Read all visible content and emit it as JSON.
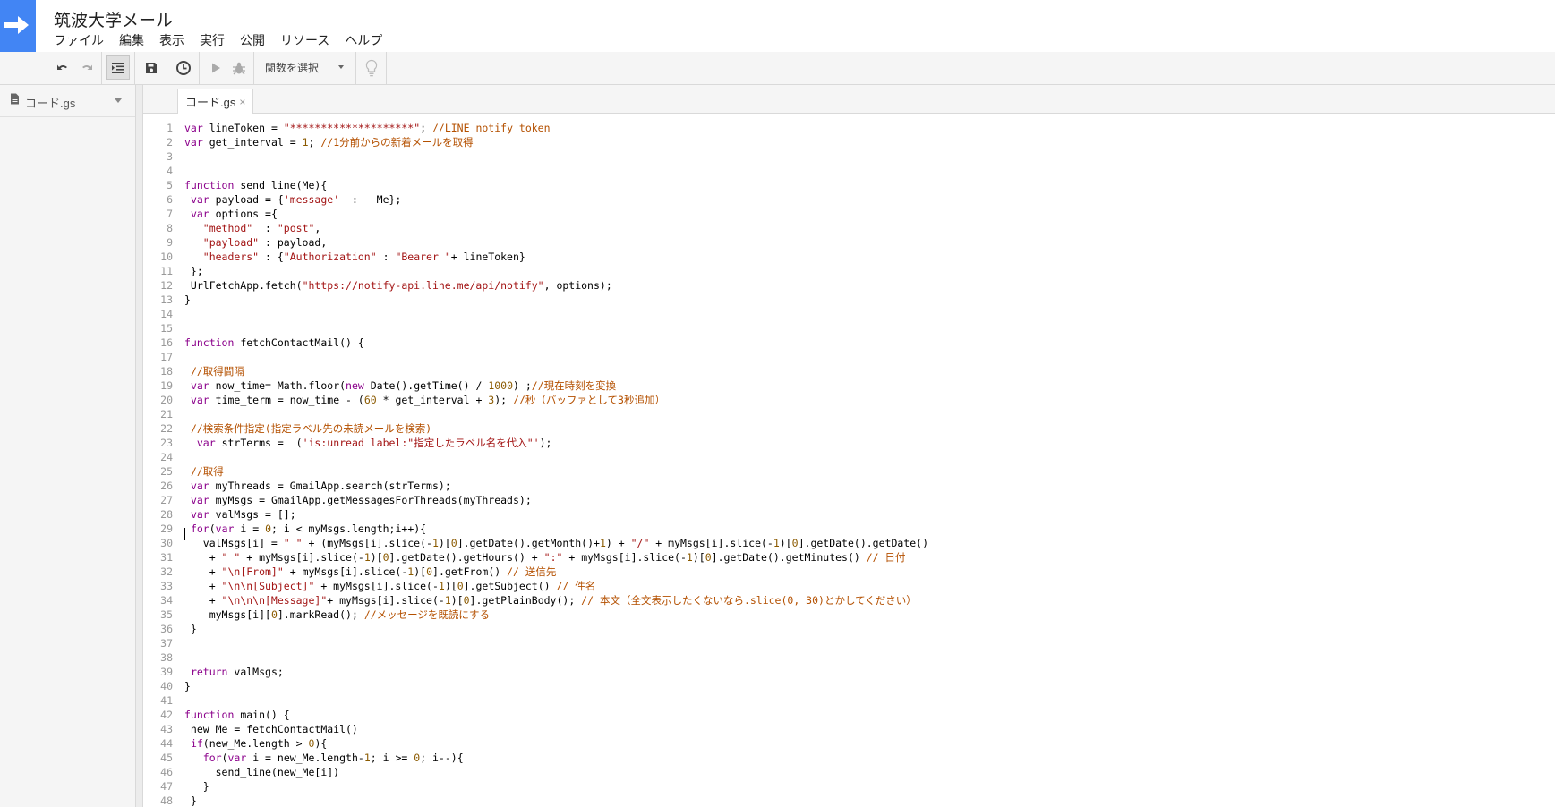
{
  "app": {
    "title": "筑波大学メール",
    "logo_color": "#4285f4"
  },
  "menu": [
    "ファイル",
    "編集",
    "表示",
    "実行",
    "公開",
    "リソース",
    "ヘルプ"
  ],
  "toolbar": {
    "icons": [
      "undo-icon",
      "redo-icon",
      "indent-icon",
      "save-icon",
      "triggers-clock-icon",
      "run-icon",
      "debug-icon",
      "bulb-icon"
    ],
    "function_select": "関数を選択"
  },
  "sidebar": {
    "file_name": "コード.gs"
  },
  "tab": {
    "label": "コード.gs",
    "close": "×"
  },
  "code": {
    "line_numbers": [
      "1",
      "2",
      "3",
      "4",
      "5",
      "6",
      "7",
      "8",
      "9",
      "10",
      "11",
      "12",
      "13",
      "14",
      "15",
      "16",
      "17",
      "18",
      "19",
      "20",
      "21",
      "22",
      "23",
      "24",
      "25",
      "26",
      "27",
      "28",
      "29",
      "30",
      "31",
      "32",
      "33",
      "34",
      "35",
      "36",
      "37",
      "38",
      "39",
      "40",
      "41",
      "42",
      "43",
      "44",
      "45",
      "46",
      "47",
      "48"
    ],
    "lines": [
      "var lineToken = \"********************\"; //LINE notify token",
      "var get_interval = 1; //1分前からの新着メールを取得",
      "",
      "",
      "function send_line(Me){",
      " var payload = {'message'  :   Me};",
      " var options ={",
      "   \"method\"  : \"post\",",
      "   \"payload\" : payload,",
      "   \"headers\" : {\"Authorization\" : \"Bearer \"+ lineToken}",
      " };",
      " UrlFetchApp.fetch(\"https://notify-api.line.me/api/notify\", options);",
      "}",
      "",
      "",
      "function fetchContactMail() {",
      "",
      " //取得間隔",
      " var now_time= Math.floor(new Date().getTime() / 1000) ;//現在時刻を変換",
      " var time_term = now_time - (60 * get_interval + 3); //秒（バッファとして3秒追加）",
      "",
      " //検索条件指定(指定ラベル先の未読メールを検索)",
      "  var strTerms =  ('is:unread label:\"指定したラベル名を代入\"');",
      "",
      " //取得",
      " var myThreads = GmailApp.search(strTerms);",
      " var myMsgs = GmailApp.getMessagesForThreads(myThreads);",
      " var valMsgs = [];",
      " for(var i = 0; i < myMsgs.length;i++){",
      "   valMsgs[i] = \" \" + (myMsgs[i].slice(-1)[0].getDate().getMonth()+1) + \"/\" + myMsgs[i].slice(-1)[0].getDate().getDate()",
      "    + \" \" + myMsgs[i].slice(-1)[0].getDate().getHours() + \":\" + myMsgs[i].slice(-1)[0].getDate().getMinutes() // 日付",
      "    + \"\\n[From]\" + myMsgs[i].slice(-1)[0].getFrom() // 送信先",
      "    + \"\\n\\n[Subject]\" + myMsgs[i].slice(-1)[0].getSubject() // 件名",
      "    + \"\\n\\n\\n[Message]\"+ myMsgs[i].slice(-1)[0].getPlainBody(); // 本文（全文表示したくないなら.slice(0, 30)とかしてください）",
      "    myMsgs[i][0].markRead(); //メッセージを既読にする",
      " }",
      "",
      "",
      " return valMsgs;",
      "}",
      "",
      "function main() {",
      " new_Me = fetchContactMail()",
      " if(new_Me.length > 0){",
      "   for(var i = new_Me.length-1; i >= 0; i--){",
      "     send_line(new_Me[i])",
      "   }",
      " }"
    ]
  }
}
